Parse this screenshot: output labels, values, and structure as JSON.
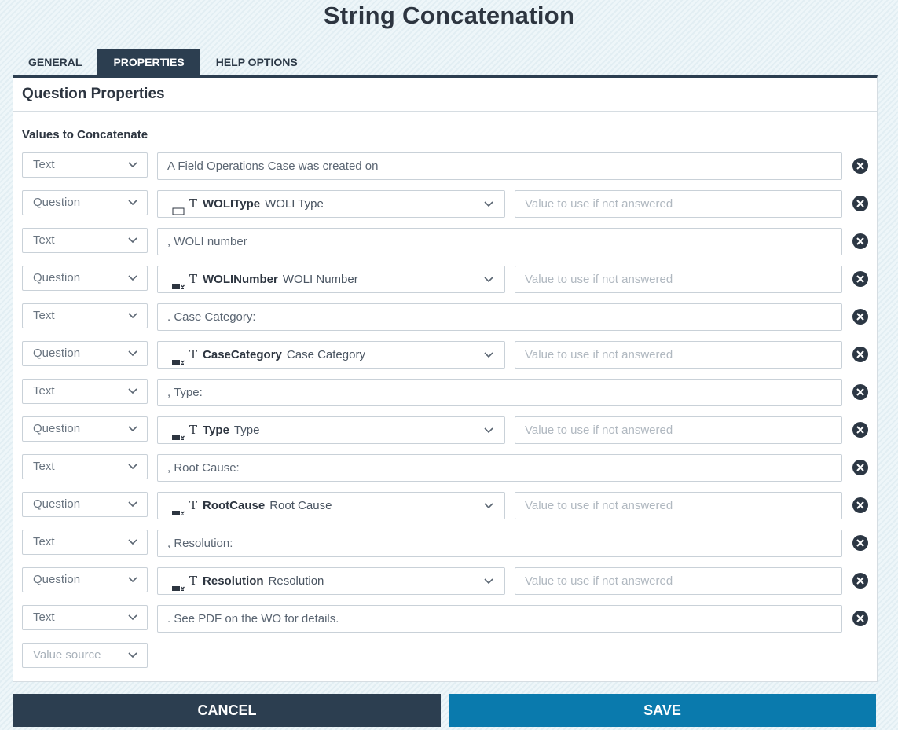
{
  "dialog": {
    "title": "String Concatenation"
  },
  "tabs": [
    {
      "label": "GENERAL",
      "active": false
    },
    {
      "label": "PROPERTIES",
      "active": true
    },
    {
      "label": "HELP OPTIONS",
      "active": false
    }
  ],
  "panel": {
    "header": "Question Properties",
    "section_label": "Values to Concatenate",
    "fallback_placeholder": "Value to use if not answered",
    "rows": [
      {
        "source": "Text",
        "value": "A Field Operations Case was created on"
      },
      {
        "source": "Question",
        "icon": "input-box-icon",
        "name": "WOLIType",
        "label": "WOLI Type"
      },
      {
        "source": "Text",
        "value": ", WOLI number"
      },
      {
        "source": "Question",
        "icon": "dropdown-field-icon",
        "name": "WOLINumber",
        "label": "WOLI Number"
      },
      {
        "source": "Text",
        "value": ". Case Category:"
      },
      {
        "source": "Question",
        "icon": "dropdown-field-icon",
        "name": "CaseCategory",
        "label": "Case Category"
      },
      {
        "source": "Text",
        "value": ", Type:"
      },
      {
        "source": "Question",
        "icon": "dropdown-field-icon",
        "name": "Type",
        "label": "Type"
      },
      {
        "source": "Text",
        "value": ", Root Cause:"
      },
      {
        "source": "Question",
        "icon": "dropdown-field-icon",
        "name": "RootCause",
        "label": "Root Cause"
      },
      {
        "source": "Text",
        "value": ", Resolution:"
      },
      {
        "source": "Question",
        "icon": "dropdown-field-icon",
        "name": "Resolution",
        "label": "Resolution"
      },
      {
        "source": "Text",
        "value": ". See PDF on the WO for details."
      }
    ],
    "value_source_placeholder": "Value source"
  },
  "footer": {
    "cancel_label": "CANCEL",
    "save_label": "SAVE"
  },
  "colors": {
    "primary_dark": "#2c3e50",
    "save_blue": "#0a7aad"
  }
}
